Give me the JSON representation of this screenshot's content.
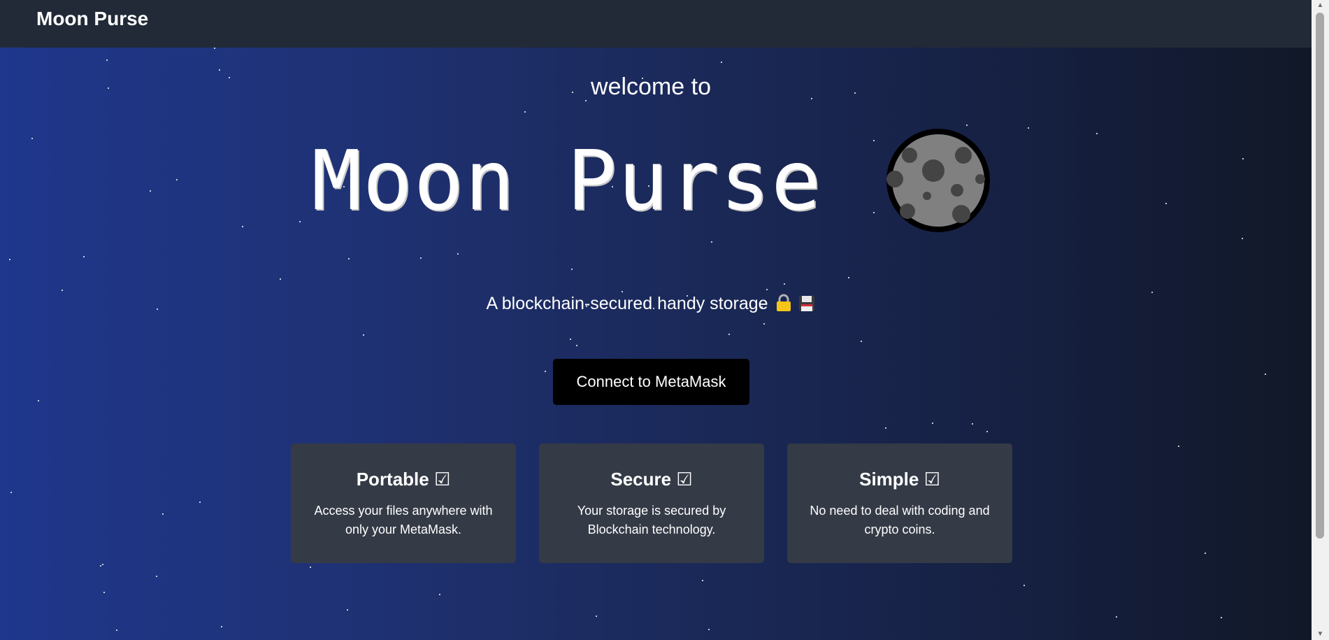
{
  "navbar": {
    "brand": "Moon Purse"
  },
  "hero": {
    "welcome": "welcome to",
    "title": "Moon Purse",
    "moon_icon": "moon-icon",
    "tagline": "A blockchain-secured handy storage",
    "tagline_icons": [
      "lock-icon",
      "floppy-disk-icon"
    ],
    "connect_button": "Connect to MetaMask"
  },
  "cards": [
    {
      "title": "Portable ☑",
      "text": "Access your files anywhere with only your MetaMask."
    },
    {
      "title": "Secure ☑",
      "text": "Your storage is secured by Blockchain technology."
    },
    {
      "title": "Simple ☑",
      "text": "No need to deal with coding and crypto coins."
    }
  ],
  "colors": {
    "navbar": "#222a37",
    "gradient_start": "#1f378c",
    "gradient_end": "#111827",
    "card": "#343a46",
    "button": "#000000"
  }
}
